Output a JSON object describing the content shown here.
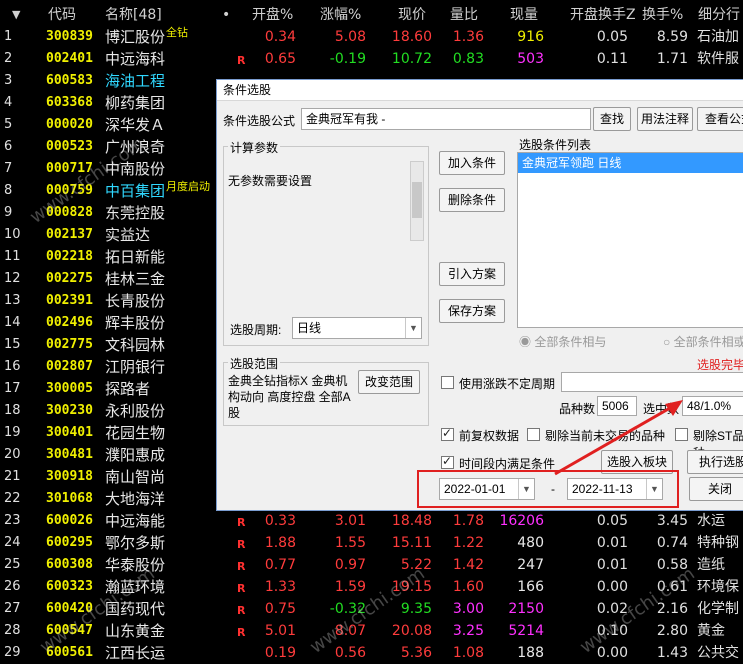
{
  "header": {
    "sort_icon": "▼",
    "code": "代码",
    "name": "名称[48]",
    "dot": "•",
    "open_pct": "开盘%",
    "change_pct": "涨幅%",
    "price": "现价",
    "vol_ratio": "量比",
    "cur_vol": "现量",
    "open_turnover": "开盘换手Z",
    "turnover": "换手%",
    "industry": "细分行"
  },
  "rows": [
    {
      "idx": "1",
      "code": "300839",
      "name": "博汇股份",
      "tag": "全钻",
      "r": "",
      "v1": "0.34",
      "v2": "5.08",
      "v3": "18.60",
      "v4": "1.36",
      "v5": "916",
      "v6": "0.05",
      "v7": "8.59",
      "v8": "石油加",
      "c1": "red",
      "c2": "red",
      "c3": "red",
      "c4": "red",
      "c5": "yel",
      "nc": "white"
    },
    {
      "idx": "2",
      "code": "002401",
      "name": "中远海科",
      "tag": "",
      "r": "R",
      "v1": "0.65",
      "v2": "-0.19",
      "v3": "10.72",
      "v4": "0.83",
      "v5": "503",
      "v6": "0.11",
      "v7": "1.71",
      "v8": "软件服",
      "c1": "red",
      "c2": "green",
      "c3": "green",
      "c4": "green",
      "c5": "mag",
      "nc": "white"
    },
    {
      "idx": "3",
      "code": "600583",
      "name": "海油工程",
      "tag": "",
      "r": "",
      "v1": "",
      "v2": "",
      "v3": "",
      "v4": "",
      "v5": "",
      "v6": "",
      "v7": "",
      "v8": "",
      "c1": "red",
      "c2": "red",
      "c3": "red",
      "c4": "red",
      "c5": "yel",
      "nc": "cyan"
    },
    {
      "idx": "4",
      "code": "603368",
      "name": "柳药集团",
      "tag": "",
      "r": "",
      "v1": "",
      "v2": "",
      "v3": "",
      "v4": "",
      "v5": "",
      "v6": "",
      "v7": "",
      "v8": "",
      "c1": "red",
      "c2": "red",
      "c3": "red",
      "c4": "red",
      "c5": "yel",
      "nc": "white"
    },
    {
      "idx": "5",
      "code": "000020",
      "name": "深华发Ａ",
      "tag": "",
      "r": "",
      "v1": "",
      "v2": "",
      "v3": "",
      "v4": "",
      "v5": "",
      "v6": "",
      "v7": "",
      "v8": "",
      "c1": "red",
      "c2": "red",
      "c3": "red",
      "c4": "red",
      "c5": "yel",
      "nc": "white"
    },
    {
      "idx": "6",
      "code": "000523",
      "name": "广州浪奇",
      "tag": "",
      "r": "",
      "v1": "",
      "v2": "",
      "v3": "",
      "v4": "",
      "v5": "",
      "v6": "",
      "v7": "",
      "v8": "",
      "c1": "red",
      "c2": "red",
      "c3": "red",
      "c4": "red",
      "c5": "yel",
      "nc": "white"
    },
    {
      "idx": "7",
      "code": "000717",
      "name": "中南股份",
      "tag": "",
      "r": "",
      "v1": "",
      "v2": "",
      "v3": "",
      "v4": "",
      "v5": "",
      "v6": "",
      "v7": "",
      "v8": "",
      "c1": "red",
      "c2": "red",
      "c3": "red",
      "c4": "red",
      "c5": "yel",
      "nc": "white"
    },
    {
      "idx": "8",
      "code": "000759",
      "name": "中百集团",
      "tag": "月度启动",
      "r": "",
      "v1": "",
      "v2": "",
      "v3": "",
      "v4": "",
      "v5": "",
      "v6": "",
      "v7": "",
      "v8": "",
      "c1": "red",
      "c2": "red",
      "c3": "red",
      "c4": "red",
      "c5": "yel",
      "nc": "cyan"
    },
    {
      "idx": "9",
      "code": "000828",
      "name": "东莞控股",
      "tag": "",
      "r": "",
      "v1": "",
      "v2": "",
      "v3": "",
      "v4": "",
      "v5": "",
      "v6": "",
      "v7": "",
      "v8": "",
      "c1": "red",
      "c2": "red",
      "c3": "red",
      "c4": "red",
      "c5": "yel",
      "nc": "white"
    },
    {
      "idx": "10",
      "code": "002137",
      "name": "实益达",
      "tag": "",
      "r": "",
      "v1": "",
      "v2": "",
      "v3": "",
      "v4": "",
      "v5": "",
      "v6": "",
      "v7": "",
      "v8": "",
      "c1": "red",
      "c2": "red",
      "c3": "red",
      "c4": "red",
      "c5": "yel",
      "nc": "white"
    },
    {
      "idx": "11",
      "code": "002218",
      "name": "拓日新能",
      "tag": "",
      "r": "",
      "v1": "",
      "v2": "",
      "v3": "",
      "v4": "",
      "v5": "",
      "v6": "",
      "v7": "",
      "v8": "",
      "c1": "red",
      "c2": "red",
      "c3": "red",
      "c4": "red",
      "c5": "yel",
      "nc": "white"
    },
    {
      "idx": "12",
      "code": "002275",
      "name": "桂林三金",
      "tag": "",
      "r": "",
      "v1": "",
      "v2": "",
      "v3": "",
      "v4": "",
      "v5": "",
      "v6": "",
      "v7": "",
      "v8": "",
      "c1": "red",
      "c2": "red",
      "c3": "red",
      "c4": "red",
      "c5": "yel",
      "nc": "white"
    },
    {
      "idx": "13",
      "code": "002391",
      "name": "长青股份",
      "tag": "",
      "r": "",
      "v1": "",
      "v2": "",
      "v3": "",
      "v4": "",
      "v5": "",
      "v6": "",
      "v7": "",
      "v8": "",
      "c1": "red",
      "c2": "red",
      "c3": "red",
      "c4": "red",
      "c5": "yel",
      "nc": "white"
    },
    {
      "idx": "14",
      "code": "002496",
      "name": "辉丰股份",
      "tag": "",
      "r": "",
      "v1": "",
      "v2": "",
      "v3": "",
      "v4": "",
      "v5": "",
      "v6": "",
      "v7": "",
      "v8": "",
      "c1": "red",
      "c2": "red",
      "c3": "red",
      "c4": "red",
      "c5": "yel",
      "nc": "white"
    },
    {
      "idx": "15",
      "code": "002775",
      "name": "文科园林",
      "tag": "",
      "r": "",
      "v1": "",
      "v2": "",
      "v3": "",
      "v4": "",
      "v5": "",
      "v6": "",
      "v7": "",
      "v8": "",
      "c1": "red",
      "c2": "red",
      "c3": "red",
      "c4": "red",
      "c5": "yel",
      "nc": "white"
    },
    {
      "idx": "16",
      "code": "002807",
      "name": "江阴银行",
      "tag": "",
      "r": "",
      "v1": "",
      "v2": "",
      "v3": "",
      "v4": "",
      "v5": "",
      "v6": "",
      "v7": "",
      "v8": "",
      "c1": "red",
      "c2": "red",
      "c3": "red",
      "c4": "red",
      "c5": "yel",
      "nc": "white"
    },
    {
      "idx": "17",
      "code": "300005",
      "name": "探路者",
      "tag": "",
      "r": "",
      "v1": "",
      "v2": "",
      "v3": "",
      "v4": "",
      "v5": "",
      "v6": "",
      "v7": "",
      "v8": "",
      "c1": "red",
      "c2": "red",
      "c3": "red",
      "c4": "red",
      "c5": "yel",
      "nc": "white"
    },
    {
      "idx": "18",
      "code": "300230",
      "name": "永利股份",
      "tag": "",
      "r": "",
      "v1": "",
      "v2": "",
      "v3": "",
      "v4": "",
      "v5": "",
      "v6": "",
      "v7": "",
      "v8": "",
      "c1": "red",
      "c2": "red",
      "c3": "red",
      "c4": "red",
      "c5": "yel",
      "nc": "white"
    },
    {
      "idx": "19",
      "code": "300401",
      "name": "花园生物",
      "tag": "",
      "r": "",
      "v1": "",
      "v2": "",
      "v3": "",
      "v4": "",
      "v5": "",
      "v6": "",
      "v7": "",
      "v8": "",
      "c1": "red",
      "c2": "red",
      "c3": "red",
      "c4": "red",
      "c5": "yel",
      "nc": "white"
    },
    {
      "idx": "20",
      "code": "300481",
      "name": "濮阳惠成",
      "tag": "",
      "r": "",
      "v1": "",
      "v2": "",
      "v3": "",
      "v4": "",
      "v5": "",
      "v6": "",
      "v7": "",
      "v8": "",
      "c1": "red",
      "c2": "red",
      "c3": "red",
      "c4": "red",
      "c5": "yel",
      "nc": "white"
    },
    {
      "idx": "21",
      "code": "300918",
      "name": "南山智尚",
      "tag": "",
      "r": "",
      "v1": "",
      "v2": "",
      "v3": "",
      "v4": "",
      "v5": "",
      "v6": "",
      "v7": "",
      "v8": "",
      "c1": "red",
      "c2": "red",
      "c3": "red",
      "c4": "red",
      "c5": "yel",
      "nc": "white"
    },
    {
      "idx": "22",
      "code": "301068",
      "name": "大地海洋",
      "tag": "",
      "r": "",
      "v1": "",
      "v2": "",
      "v3": "",
      "v4": "",
      "v5": "",
      "v6": "",
      "v7": "",
      "v8": "",
      "c1": "red",
      "c2": "red",
      "c3": "red",
      "c4": "red",
      "c5": "yel",
      "nc": "white"
    },
    {
      "idx": "23",
      "code": "600026",
      "name": "中远海能",
      "tag": "",
      "r": "R",
      "v1": "0.33",
      "v2": "3.01",
      "v3": "18.48",
      "v4": "1.78",
      "v5": "16206",
      "v6": "0.05",
      "v7": "3.45",
      "v8": "水运",
      "c1": "red",
      "c2": "red",
      "c3": "red",
      "c4": "red",
      "c5": "mag",
      "nc": "white"
    },
    {
      "idx": "24",
      "code": "600295",
      "name": "鄂尔多斯",
      "tag": "",
      "r": "R",
      "v1": "1.88",
      "v2": "1.55",
      "v3": "15.11",
      "v4": "1.22",
      "v5": "480",
      "v6": "0.01",
      "v7": "0.74",
      "v8": "特种钢",
      "c1": "red",
      "c2": "red",
      "c3": "red",
      "c4": "red",
      "c5": "white",
      "nc": "white"
    },
    {
      "idx": "25",
      "code": "600308",
      "name": "华泰股份",
      "tag": "",
      "r": "R",
      "v1": "0.77",
      "v2": "0.97",
      "v3": "5.22",
      "v4": "1.42",
      "v5": "247",
      "v6": "0.01",
      "v7": "0.58",
      "v8": "造纸",
      "c1": "red",
      "c2": "red",
      "c3": "red",
      "c4": "red",
      "c5": "white",
      "nc": "white"
    },
    {
      "idx": "26",
      "code": "600323",
      "name": "瀚蓝环境",
      "tag": "",
      "r": "R",
      "v1": "1.33",
      "v2": "1.59",
      "v3": "19.15",
      "v4": "1.60",
      "v5": "166",
      "v6": "0.00",
      "v7": "0.61",
      "v8": "环境保",
      "c1": "red",
      "c2": "red",
      "c3": "red",
      "c4": "red",
      "c5": "white",
      "nc": "white"
    },
    {
      "idx": "27",
      "code": "600420",
      "name": "国药现代",
      "tag": "",
      "r": "R",
      "v1": "0.75",
      "v2": "-0.32",
      "v3": "9.35",
      "v4": "3.00",
      "v5": "2150",
      "v6": "0.02",
      "v7": "2.16",
      "v8": "化学制",
      "c1": "red",
      "c2": "green",
      "c3": "green",
      "c4": "mag",
      "c5": "mag",
      "nc": "white"
    },
    {
      "idx": "28",
      "code": "600547",
      "name": "山东黄金",
      "tag": "",
      "r": "R",
      "v1": "5.01",
      "v2": "8.07",
      "v3": "20.08",
      "v4": "3.25",
      "v5": "5214",
      "v6": "0.10",
      "v7": "2.80",
      "v8": "黄金",
      "c1": "red",
      "c2": "red",
      "c3": "red",
      "c4": "mag",
      "c5": "mag",
      "nc": "white"
    },
    {
      "idx": "29",
      "code": "600561",
      "name": "江西长运",
      "tag": "",
      "r": "",
      "v1": "0.19",
      "v2": "0.56",
      "v3": "5.36",
      "v4": "1.08",
      "v5": "188",
      "v6": "0.00",
      "v7": "1.43",
      "v8": "公共交",
      "c1": "red",
      "c2": "red",
      "c3": "red",
      "c4": "red",
      "c5": "white",
      "nc": "white"
    }
  ],
  "dialog": {
    "title": "条件选股",
    "formula_label": "条件选股公式",
    "formula_value": "金典冠军有我 -",
    "find_btn": "查找",
    "usage_btn": "用法注释",
    "view_btn": "查看公式",
    "calc_params_label": "计算参数",
    "no_params": "无参数需要设置",
    "add_btn": "加入条件",
    "delete_btn": "删除条件",
    "list_label": "选股条件列表",
    "list_item": "金典冠军领跑  日线",
    "import_btn": "引入方案",
    "save_btn": "保存方案",
    "period_label": "选股周期:",
    "period_value": "日线",
    "radio_and": "全部条件相与",
    "radio_or": "全部条件相或",
    "status_done": "选股完毕",
    "range_label": "选股范围",
    "range_text": "金典全钻指标X 金典机构动向 高度控盘 全部A股",
    "range_btn": "改变范围",
    "use_limit_label": "使用涨跌不定周期",
    "total_label": "品种数",
    "total_value": "5006",
    "selected_label": "选中数",
    "selected_value": "48/1.0%",
    "fq_label": "前复权数据",
    "exclude_label": "剔除当前未交易的品种",
    "exclude_st_label": "剔除ST品种",
    "timeframe_label": "时间段内满足条件",
    "to_block_btn": "选股入板块",
    "exec_btn": "执行选股",
    "date_start": "2022-01-01",
    "date_sep": "-",
    "date_end": "2022-11-13",
    "close_btn": "关闭"
  },
  "watermark": "www.cfchi.com",
  "colors": {
    "accent_red": "#e02020",
    "selected_blue": "#3399ff",
    "red": "#ff3c3c",
    "green": "#22dd22",
    "yellow": "#f0f000",
    "magenta": "#ff30ff",
    "cyan": "#30d8ff"
  }
}
